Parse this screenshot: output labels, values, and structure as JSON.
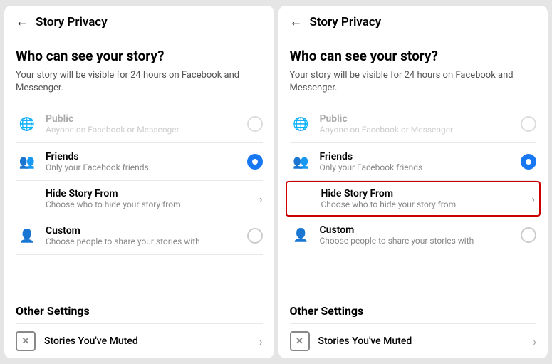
{
  "panels": [
    {
      "id": "panel-left",
      "header": {
        "back_label": "←",
        "title": "Story Privacy"
      },
      "main": {
        "question": "Who can see your story?",
        "description": "Your story will be visible for 24 hours on Facebook and Messenger.",
        "options": [
          {
            "id": "public",
            "icon": "🌐",
            "label": "Public",
            "sublabel": "Anyone on Facebook or Messenger",
            "type": "radio",
            "selected": false,
            "disabled": true,
            "highlighted": false
          },
          {
            "id": "friends",
            "icon": "👥",
            "label": "Friends",
            "sublabel": "Only your Facebook friends",
            "type": "radio",
            "selected": true,
            "disabled": false,
            "highlighted": false
          },
          {
            "id": "hide-story-from",
            "icon": "",
            "label": "Hide Story From",
            "sublabel": "Choose who to hide your story from",
            "type": "chevron",
            "selected": false,
            "disabled": false,
            "highlighted": false
          },
          {
            "id": "custom",
            "icon": "👤",
            "label": "Custom",
            "sublabel": "Choose people to share your stories with",
            "type": "radio",
            "selected": false,
            "disabled": false,
            "highlighted": false
          }
        ]
      },
      "other_settings": {
        "title": "Other Settings",
        "items": [
          {
            "id": "muted",
            "icon": "✕",
            "label": "Stories You've Muted",
            "type": "chevron"
          }
        ]
      }
    },
    {
      "id": "panel-right",
      "header": {
        "back_label": "←",
        "title": "Story Privacy"
      },
      "main": {
        "question": "Who can see your story?",
        "description": "Your story will be visible for 24 hours on Facebook and Messenger.",
        "options": [
          {
            "id": "public",
            "icon": "🌐",
            "label": "Public",
            "sublabel": "Anyone on Facebook or Messenger",
            "type": "radio",
            "selected": false,
            "disabled": true,
            "highlighted": false
          },
          {
            "id": "friends",
            "icon": "👥",
            "label": "Friends",
            "sublabel": "Only your Facebook friends",
            "type": "radio",
            "selected": true,
            "disabled": false,
            "highlighted": false
          },
          {
            "id": "hide-story-from",
            "icon": "",
            "label": "Hide Story From",
            "sublabel": "Choose who to hide your story from",
            "type": "chevron",
            "selected": false,
            "disabled": false,
            "highlighted": true
          },
          {
            "id": "custom",
            "icon": "👤",
            "label": "Custom",
            "sublabel": "Choose people to share your stories with",
            "type": "radio",
            "selected": false,
            "disabled": false,
            "highlighted": false
          }
        ]
      },
      "other_settings": {
        "title": "Other Settings",
        "items": [
          {
            "id": "muted",
            "icon": "✕",
            "label": "Stories You've Muted",
            "type": "chevron"
          }
        ]
      }
    }
  ]
}
